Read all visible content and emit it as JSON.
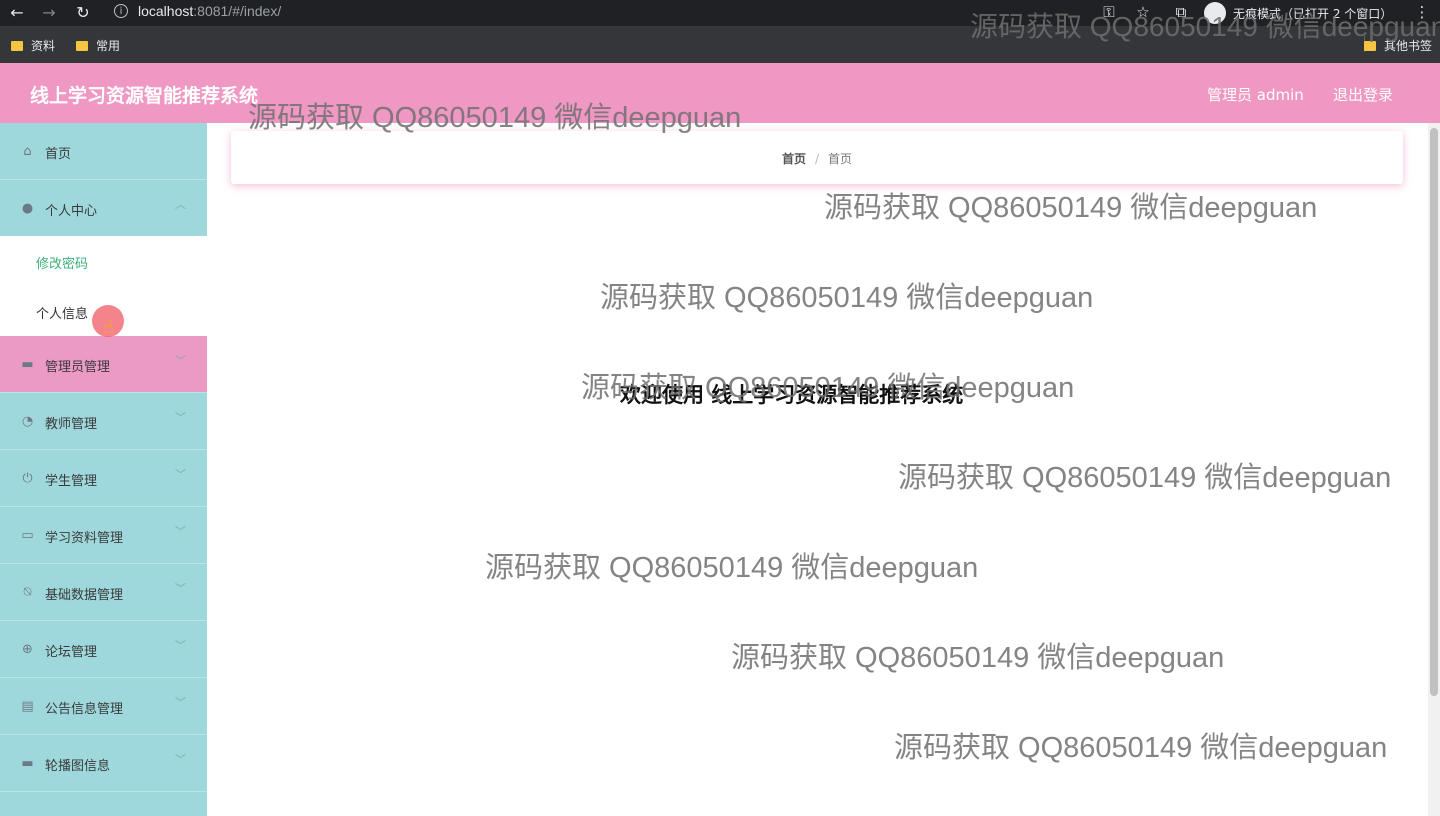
{
  "browser": {
    "url_host": "localhost",
    "url_rest": ":8081/#/index/",
    "incognito_text": "无痕模式（已打开 2 个窗口）",
    "bookmarks": [
      "资料",
      "常用"
    ],
    "other_bookmarks": "其他书签"
  },
  "header": {
    "title": "线上学习资源智能推荐系统",
    "admin_label": "管理员 admin",
    "logout_label": "退出登录"
  },
  "sidebar": {
    "items": [
      {
        "label": "首页",
        "icon": "home-icon"
      },
      {
        "label": "个人中心",
        "icon": "user-icon"
      },
      {
        "label": "管理员管理",
        "icon": "monitor-icon"
      },
      {
        "label": "教师管理",
        "icon": "dashboard-icon"
      },
      {
        "label": "学生管理",
        "icon": "power-icon"
      },
      {
        "label": "学习资料管理",
        "icon": "chat-icon"
      },
      {
        "label": "基础数据管理",
        "icon": "bell-off-icon"
      },
      {
        "label": "论坛管理",
        "icon": "crosshair-icon"
      },
      {
        "label": "公告信息管理",
        "icon": "clipboard-icon"
      },
      {
        "label": "轮播图信息",
        "icon": "monitor-icon"
      }
    ],
    "submenu": [
      "修改密码",
      "个人信息"
    ]
  },
  "breadcrumb": {
    "home": "首页",
    "current": "首页"
  },
  "main": {
    "welcome": "欢迎使用 线上学习资源智能推荐系统"
  },
  "watermark": "源码获取 QQ86050149 微信deepguan",
  "colors": {
    "header_bg": "#ef98c3",
    "sidebar_bg": "#9fd8dc",
    "active_item_bg": "#ea9ac4",
    "submenu_active_text": "#3bb07a"
  }
}
